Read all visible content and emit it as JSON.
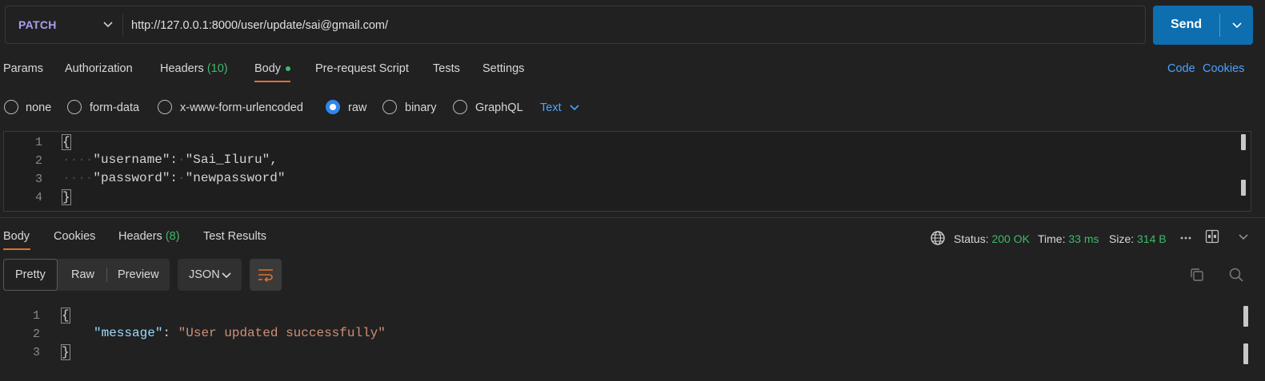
{
  "request": {
    "method": "PATCH",
    "url": "http://127.0.0.1:8000/user/update/sai@gmail.com/",
    "send_label": "Send"
  },
  "request_tabs": {
    "params": "Params",
    "authorization": "Authorization",
    "headers": "Headers",
    "headers_count": "(10)",
    "body": "Body",
    "pre_request": "Pre-request Script",
    "tests": "Tests",
    "settings": "Settings",
    "code": "Code",
    "cookies": "Cookies"
  },
  "body_types": {
    "none": "none",
    "form_data": "form-data",
    "urlencoded": "x-www-form-urlencoded",
    "raw": "raw",
    "binary": "binary",
    "graphql": "GraphQL",
    "selected": "raw",
    "format": "Text"
  },
  "request_body": {
    "line_numbers": [
      "1",
      "2",
      "3",
      "4"
    ],
    "open_brace": "{",
    "username_key": "\"username\"",
    "username_value": "\"Sai_Iluru\",",
    "password_key": "\"password\"",
    "password_value": "\"newpassword\"",
    "close_brace": "}",
    "colon": ":"
  },
  "response_tabs": {
    "body": "Body",
    "cookies": "Cookies",
    "headers": "Headers",
    "headers_count": "(8)",
    "test_results": "Test Results"
  },
  "response_status": {
    "status_label": "Status:",
    "status_value": "200 OK",
    "time_label": "Time:",
    "time_value": "33 ms",
    "size_label": "Size:",
    "size_value": "314 B"
  },
  "response_view": {
    "pretty": "Pretty",
    "raw": "Raw",
    "preview": "Preview",
    "format": "JSON"
  },
  "response_body": {
    "line_numbers": [
      "1",
      "2",
      "3"
    ],
    "open_brace": "{",
    "message_key": "\"message\"",
    "colon": ":",
    "message_value": "\"User updated successfully\"",
    "close_brace": "}"
  },
  "colors": {
    "method": "#a99ff2",
    "send_button": "#0d6eb0",
    "accent_underline": "#e46f2a",
    "green": "#3fb96b",
    "link_blue": "#4aa3ff",
    "json_key": "#9cdcfe",
    "json_string": "#ce9178"
  }
}
